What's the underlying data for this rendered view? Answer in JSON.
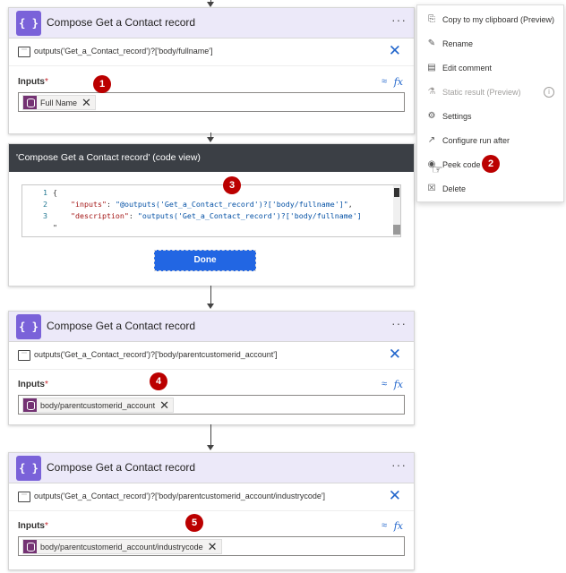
{
  "cards": [
    {
      "title": "Compose Get a Contact record",
      "comment": "outputs('Get_a_Contact_record')?['body/fullname']",
      "inputs_label": "Inputs",
      "token": "Full Name",
      "badge": "1"
    },
    {
      "title": "Compose Get a Contact record",
      "comment": "outputs('Get_a_Contact_record')?['body/parentcustomerid_account']",
      "inputs_label": "Inputs",
      "token": "body/parentcustomerid_account",
      "badge": "4"
    },
    {
      "title": "Compose Get a Contact record",
      "comment": "outputs('Get_a_Contact_record')?['body/parentcustomerid_account/industrycode']",
      "inputs_label": "Inputs",
      "token": "body/parentcustomerid_account/industrycode",
      "badge": "5"
    }
  ],
  "required_mark": "*",
  "more_dots": "···",
  "codeview": {
    "title": "'Compose Get a Contact record' (code view)",
    "badge": "3",
    "lines": [
      {
        "num": "1",
        "text": "{"
      },
      {
        "num": "2",
        "key": "\"inputs\"",
        "sep": ": ",
        "value": "\"@outputs('Get_a_Contact_record')?['body/fullname']\"",
        "tail": ","
      },
      {
        "num": "3",
        "key": "\"description\"",
        "sep": ": ",
        "value": "\"outputs('Get_a_Contact_record')?['body/fullname']",
        "tail": ""
      }
    ],
    "overflow_mark": "\"",
    "done_label": "Done"
  },
  "menu": {
    "badge": "2",
    "items": [
      {
        "label": "Copy to my clipboard (Preview)",
        "icon": "copy-icon",
        "glyph": "⎘",
        "disabled": false
      },
      {
        "label": "Rename",
        "icon": "pencil-icon",
        "glyph": "✎",
        "disabled": false
      },
      {
        "label": "Edit comment",
        "icon": "comment-icon",
        "glyph": "▤",
        "disabled": false
      },
      {
        "label": "Static result (Preview)",
        "icon": "flask-icon",
        "glyph": "⚗",
        "disabled": true
      },
      {
        "label": "Settings",
        "icon": "gear-icon",
        "glyph": "⚙",
        "disabled": false
      },
      {
        "label": "Configure run after",
        "icon": "run-after-icon",
        "glyph": "↗",
        "disabled": false
      },
      {
        "label": "Peek code",
        "icon": "eye-icon",
        "glyph": "◉",
        "disabled": false
      },
      {
        "label": "Delete",
        "icon": "trash-icon",
        "glyph": "☒",
        "disabled": false
      }
    ],
    "info_glyph": "i"
  },
  "colors": {
    "card_header": "#ece9f9",
    "action_icon": "#7a62d9",
    "token_icon": "#743273",
    "badge": "#b00000",
    "done_button": "#2266e3",
    "code_header": "#3b3f45"
  }
}
